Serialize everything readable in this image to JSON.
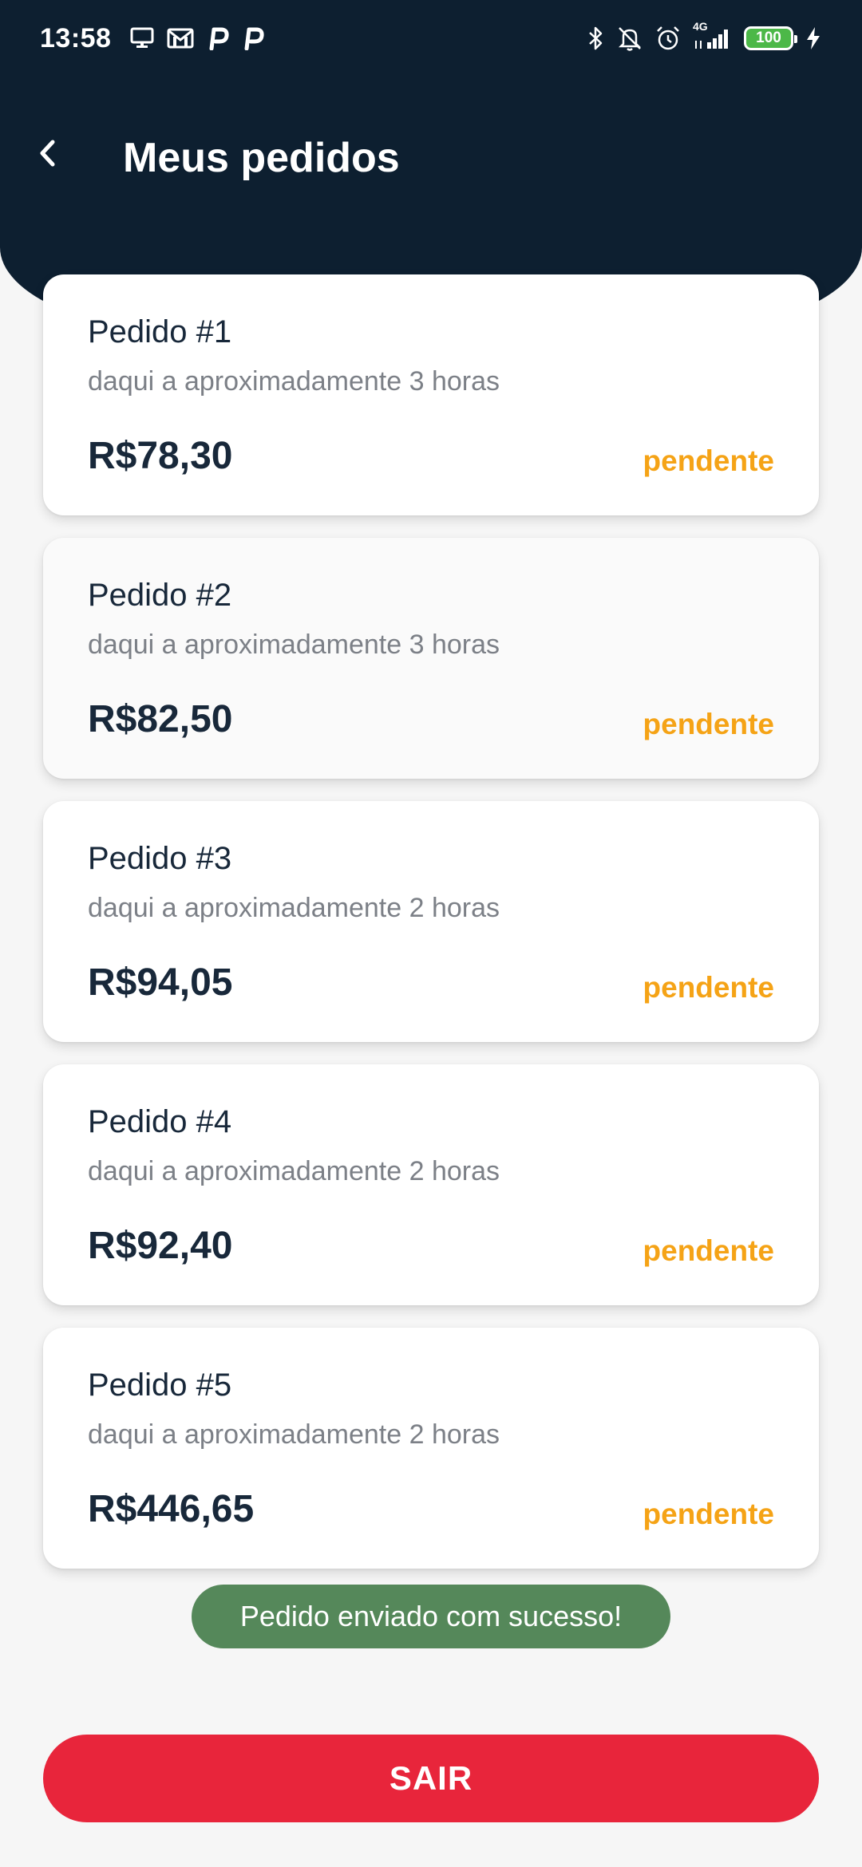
{
  "status_bar": {
    "time": "13:58",
    "left_icons": [
      "monitor-icon",
      "gmail-icon",
      "p-app-icon",
      "p-app-icon"
    ],
    "right_icons": [
      "bluetooth-icon",
      "muted-bell-icon",
      "alarm-icon",
      "signal-4g-icon"
    ],
    "network_label": "4G",
    "battery_level": "100"
  },
  "header": {
    "title": "Meus pedidos",
    "back_icon": "chevron-left-icon",
    "background_color": "#0d1f30"
  },
  "orders": [
    {
      "title": "Pedido #1",
      "time": "daqui a aproximadamente 3 horas",
      "price": "R$78,30",
      "status": "pendente"
    },
    {
      "title": "Pedido #2",
      "time": "daqui a aproximadamente 3 horas",
      "price": "R$82,50",
      "status": "pendente"
    },
    {
      "title": "Pedido #3",
      "time": "daqui a aproximadamente 2 horas",
      "price": "R$94,05",
      "status": "pendente"
    },
    {
      "title": "Pedido #4",
      "time": "daqui a aproximadamente 2 horas",
      "price": "R$92,40",
      "status": "pendente"
    },
    {
      "title": "Pedido #5",
      "time": "daqui a aproximadamente 2 horas",
      "price": "R$446,65",
      "status": "pendente"
    }
  ],
  "toast": {
    "message": "Pedido enviado com sucesso!",
    "color": "#55885a"
  },
  "exit_button": {
    "label": "SAIR",
    "color": "#e8253b"
  },
  "colors": {
    "status_pending": "#f5a316"
  }
}
